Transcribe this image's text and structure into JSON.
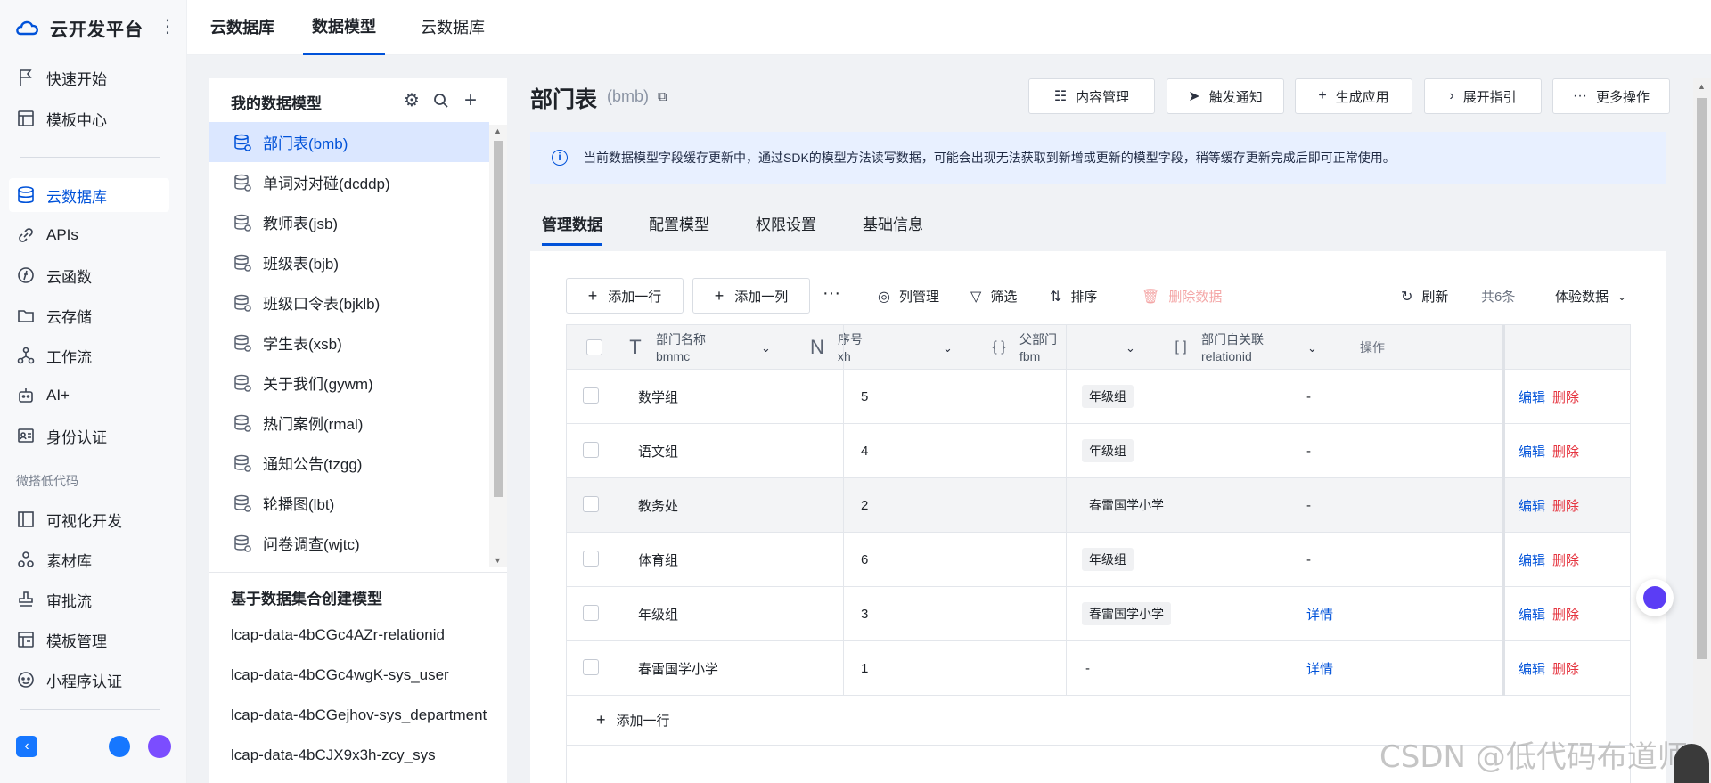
{
  "nav": {
    "brand": "云开发平台",
    "items": [
      {
        "label": "快速开始",
        "icon": "flag-icon"
      },
      {
        "label": "模板中心",
        "icon": "template-icon"
      },
      {
        "label": "云数据库",
        "icon": "database-icon",
        "active": true
      },
      {
        "label": "APIs",
        "icon": "link-icon"
      },
      {
        "label": "云函数",
        "icon": "function-icon"
      },
      {
        "label": "云存储",
        "icon": "folder-icon"
      },
      {
        "label": "工作流",
        "icon": "workflow-icon"
      },
      {
        "label": "AI+",
        "icon": "robot-icon"
      },
      {
        "label": "身份认证",
        "icon": "id-card-icon"
      },
      {
        "label": "可视化开发",
        "icon": "layout-icon"
      },
      {
        "label": "素材库",
        "icon": "assets-icon"
      },
      {
        "label": "审批流",
        "icon": "stamp-icon"
      },
      {
        "label": "模板管理",
        "icon": "template-manage-icon"
      },
      {
        "label": "小程序认证",
        "icon": "miniprogram-icon"
      }
    ],
    "group_label": "微搭低代码"
  },
  "top_tabs": [
    "云数据库",
    "数据模型",
    "云数据库"
  ],
  "models": {
    "header": "我的数据模型",
    "items": [
      "部门表(bmb)",
      "单词对对碰(dcddp)",
      "教师表(jsb)",
      "班级表(bjb)",
      "班级口令表(bjklb)",
      "学生表(xsb)",
      "关于我们(gywm)",
      "热门案例(rmal)",
      "通知公告(tzgg)",
      "轮播图(lbt)",
      "问卷调查(wjtc)"
    ],
    "dataset_header": "基于数据集合创建模型",
    "datasets": [
      "lcap-data-4bCGc4AZr-relationid",
      "lcap-data-4bCGc4wgK-sys_user",
      "lcap-data-4bCGejhov-sys_department",
      "lcap-data-4bCJX9x3h-zcy_sys"
    ]
  },
  "main": {
    "title": "部门表",
    "subtitle": "(bmb)",
    "actions": [
      "内容管理",
      "触发通知",
      "生成应用",
      "展开指引",
      "更多操作"
    ],
    "notice": "当前数据模型字段缓存更新中，通过SDK的模型方法读写数据，可能会出现无法获取到新增或更新的模型字段，稍等缓存更新完成后即可正常使用。",
    "sub_tabs": [
      "管理数据",
      "配置模型",
      "权限设置",
      "基础信息"
    ],
    "toolbar": {
      "add_row": "添加一行",
      "add_col": "添加一列",
      "col_manage": "列管理",
      "filter": "筛选",
      "sort": "排序",
      "delete": "删除数据",
      "refresh": "刷新",
      "total": "共6条",
      "env": "体验数据"
    },
    "columns": [
      {
        "label": "部门名称",
        "field": "bmmc",
        "type": "T"
      },
      {
        "label": "序号",
        "field": "xh",
        "type": "N"
      },
      {
        "label": "父部门",
        "field": "fbm",
        "type": "{ }"
      },
      {
        "label": "部门自关联",
        "field": "relationid",
        "type": "[ ]"
      },
      {
        "label": "操作"
      }
    ],
    "rows": [
      {
        "name": "数学组",
        "xh": "5",
        "fbm": "年级组",
        "rel": "-"
      },
      {
        "name": "语文组",
        "xh": "4",
        "fbm": "年级组",
        "rel": "-"
      },
      {
        "name": "教务处",
        "xh": "2",
        "fbm": "春雷国学小学",
        "rel": "-"
      },
      {
        "name": "体育组",
        "xh": "6",
        "fbm": "年级组",
        "rel": "-"
      },
      {
        "name": "年级组",
        "xh": "3",
        "fbm": "春雷国学小学",
        "rel": "详情"
      },
      {
        "name": "春雷国学小学",
        "xh": "1",
        "fbm": "-",
        "rel": "详情"
      }
    ],
    "row_actions": {
      "edit": "编辑",
      "delete": "删除"
    },
    "add_row_bottom": "添加一行"
  },
  "watermark": "CSDN @低代码布道师"
}
